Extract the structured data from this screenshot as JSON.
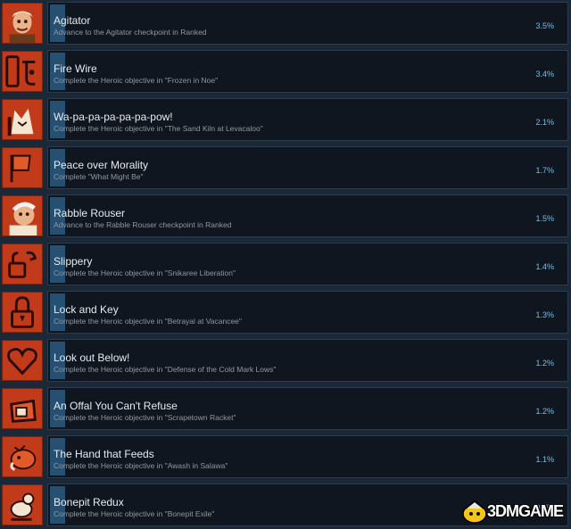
{
  "achievements": [
    {
      "name": "Agitator",
      "description": "Advance to the Agitator checkpoint in Ranked",
      "percent": "3.5%",
      "progress": 0.035,
      "icon": "agitator-character-icon"
    },
    {
      "name": "Fire Wire",
      "description": "Complete the Heroic objective in \"Frozen in Noe\"",
      "percent": "3.4%",
      "progress": 0.034,
      "icon": "fire-wire-icon"
    },
    {
      "name": "Wa-pa-pa-pa-pa-pa-pow!",
      "description": "Complete the Heroic objective in \"The Sand Kiln at Levacaloo\"",
      "percent": "2.1%",
      "progress": 0.021,
      "icon": "fox-icon"
    },
    {
      "name": "Peace over Morality",
      "description": "Complete \"What Might Be\"",
      "percent": "1.7%",
      "progress": 0.017,
      "icon": "banner-icon"
    },
    {
      "name": "Rabble Rouser",
      "description": "Advance to the Rabble Rouser checkpoint in Ranked",
      "percent": "1.5%",
      "progress": 0.015,
      "icon": "rabble-rouser-character-icon"
    },
    {
      "name": "Slippery",
      "description": "Complete the Heroic objective in \"Snikaree Liberation\"",
      "percent": "1.4%",
      "progress": 0.014,
      "icon": "broken-lock-icon"
    },
    {
      "name": "Lock and Key",
      "description": "Complete the Heroic objective in \"Betrayal at Vacancee\"",
      "percent": "1.3%",
      "progress": 0.013,
      "icon": "lock-icon"
    },
    {
      "name": "Look out Below!",
      "description": "Complete the Heroic objective in \"Defense of the Cold Mark Lows\"",
      "percent": "1.2%",
      "progress": 0.012,
      "icon": "heart-icon"
    },
    {
      "name": "An Offal You Can't Refuse",
      "description": "Complete the Heroic objective in \"Scrapetown Racket\"",
      "percent": "1.2%",
      "progress": 0.012,
      "icon": "offal-bucket-icon"
    },
    {
      "name": "The Hand that Feeds",
      "description": "Complete the Heroic objective in \"Awash in Salawa\"",
      "percent": "1.1%",
      "progress": 0.011,
      "icon": "boar-icon"
    },
    {
      "name": "Bonepit Redux",
      "description": "Complete the Heroic objective in \"Bonepit Exile\"",
      "percent": "0.7%",
      "progress": 0.007,
      "icon": "bird-icon"
    }
  ],
  "watermark": {
    "text": "3DMGAME",
    "icon": "3dmgame-logo-icon"
  },
  "colors": {
    "background": "#1b2838",
    "panel": "#10161f",
    "icon_bg": "#c13b1b",
    "progress": "#2a5b80",
    "percent": "#67c1f5"
  }
}
